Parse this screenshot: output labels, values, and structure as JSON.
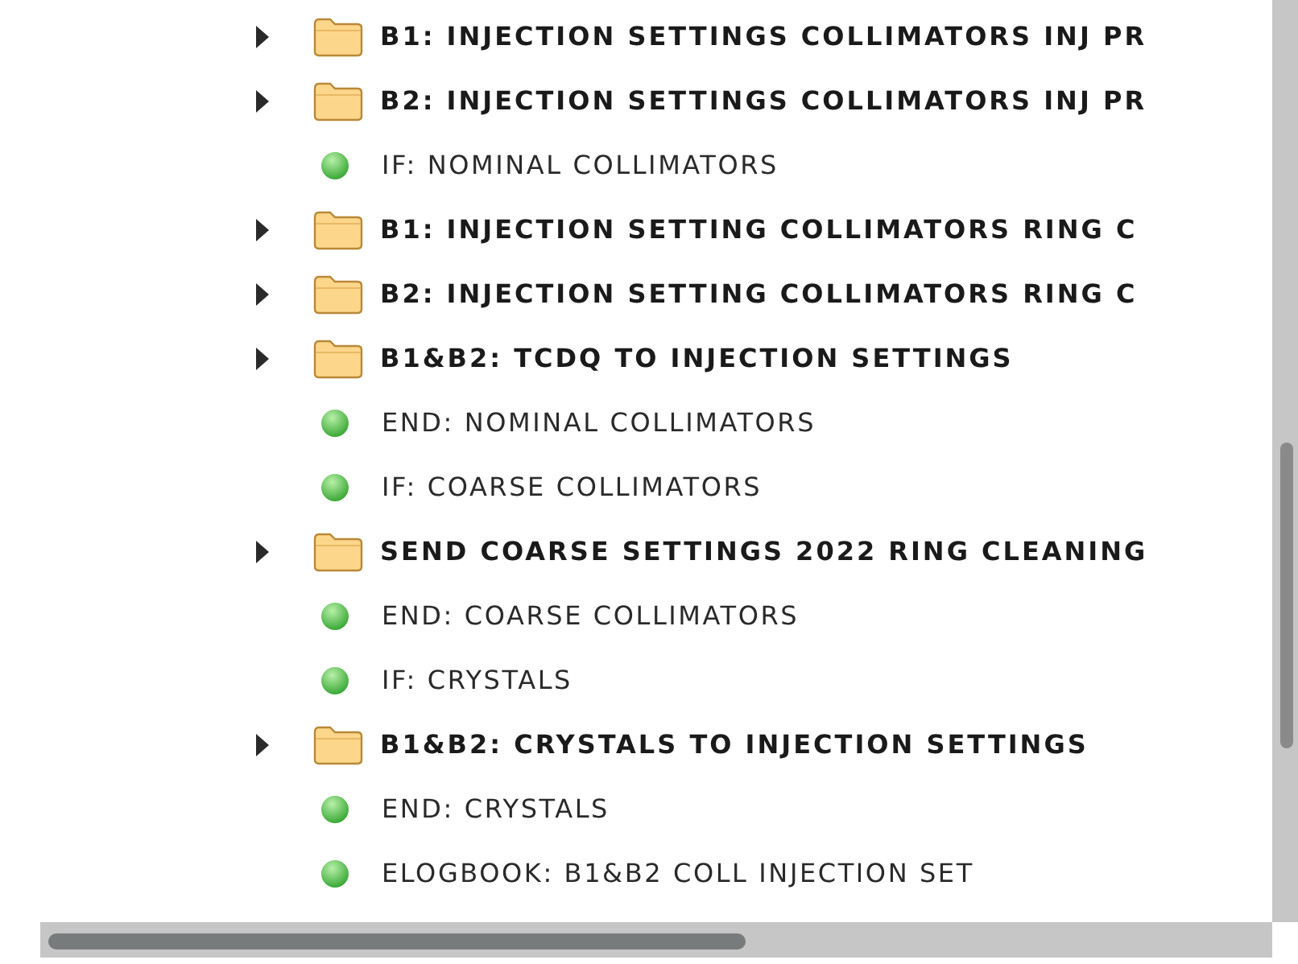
{
  "tree": {
    "rows": [
      {
        "kind": "folder",
        "label": "B1: INJECTION SETTINGS COLLIMATORS INJ PR",
        "expanded": false
      },
      {
        "kind": "folder",
        "label": "B2: INJECTION SETTINGS COLLIMATORS INJ PR",
        "expanded": false
      },
      {
        "kind": "step",
        "label": "IF: NOMINAL COLLIMATORS"
      },
      {
        "kind": "folder",
        "label": "B1: INJECTION SETTING COLLIMATORS RING C",
        "expanded": false
      },
      {
        "kind": "folder",
        "label": "B2: INJECTION SETTING COLLIMATORS RING C",
        "expanded": false
      },
      {
        "kind": "folder",
        "label": "B1&B2: TCDQ TO INJECTION SETTINGS",
        "expanded": false
      },
      {
        "kind": "step",
        "label": "END: NOMINAL COLLIMATORS"
      },
      {
        "kind": "step",
        "label": "IF: COARSE COLLIMATORS"
      },
      {
        "kind": "folder",
        "label": "SEND COARSE SETTINGS 2022 RING CLEANING",
        "expanded": false
      },
      {
        "kind": "step",
        "label": "END: COARSE COLLIMATORS"
      },
      {
        "kind": "step",
        "label": "IF: CRYSTALS"
      },
      {
        "kind": "folder",
        "label": "B1&B2: CRYSTALS TO INJECTION SETTINGS",
        "expanded": false
      },
      {
        "kind": "step",
        "label": "END: CRYSTALS"
      },
      {
        "kind": "step",
        "label": "ELOGBOOK: B1&B2 COLL INJECTION SET"
      }
    ]
  }
}
